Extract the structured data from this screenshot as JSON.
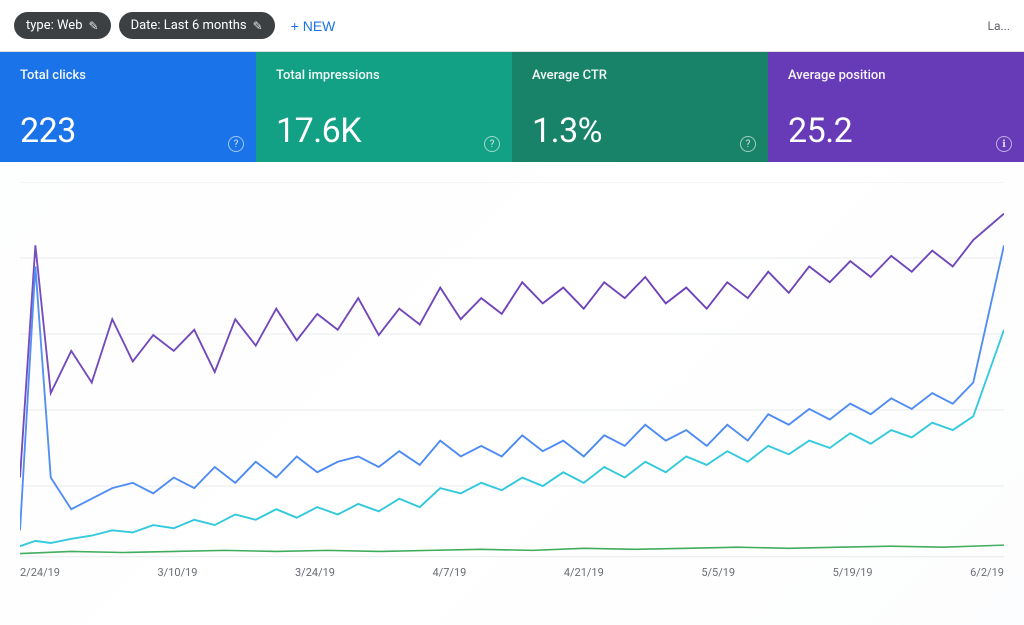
{
  "toolbar": {
    "type_filter_label": "type: Web",
    "type_filter_edit_icon": "✎",
    "date_filter_label": "Date: Last 6 months",
    "date_filter_edit_icon": "✎",
    "new_button_label": "+ NEW",
    "top_right_label": "La..."
  },
  "metrics": [
    {
      "label": "Total clicks",
      "value": "223",
      "help": "?"
    },
    {
      "label": "Total impressions",
      "value": "17.6K",
      "help": "?"
    },
    {
      "label": "Average CTR",
      "value": "1.3%",
      "help": "?"
    },
    {
      "label": "Average position",
      "value": "25.2",
      "help": "ℹ"
    }
  ],
  "chart": {
    "x_labels": [
      "2/24/19",
      "3/10/19",
      "3/24/19",
      "4/7/19",
      "4/21/19",
      "5/5/19",
      "5/19/19",
      "6/2/19"
    ],
    "series": {
      "clicks_color": "#4285f4",
      "impressions_color": "#673ab7",
      "ctr_color": "#26c6da",
      "position_color": "#34a853"
    }
  }
}
